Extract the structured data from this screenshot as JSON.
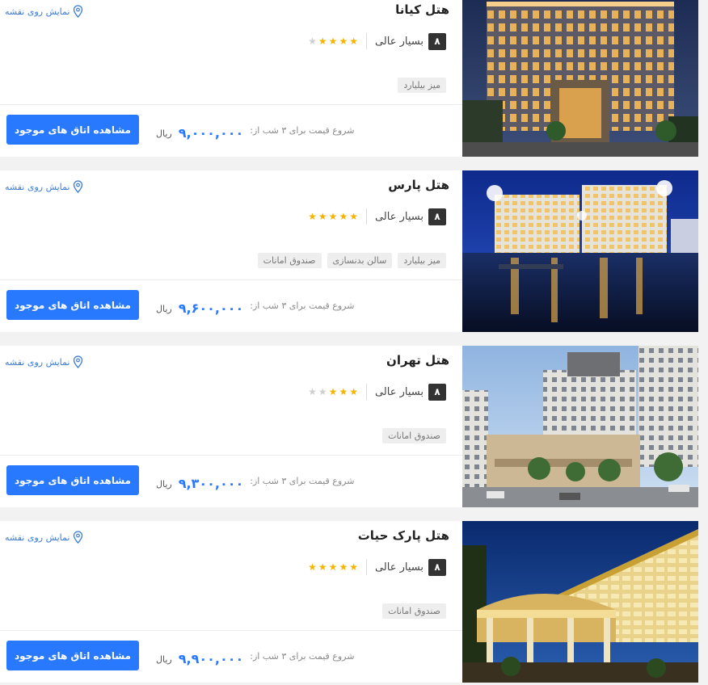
{
  "common": {
    "map_label": "نمایش روی نقشه",
    "rating_label": "بسیار عالی",
    "price_prefix": "شروع قیمت برای ۳ شب از:",
    "currency": "ریال",
    "cta_label": "مشاهده اتاق های موجود",
    "accent_color": "#2979ff",
    "star_color": "#f4b400",
    "icons": {
      "map": "map-pin-icon",
      "star": "star-icon"
    }
  },
  "hotels": [
    {
      "name": "هتل کیانا",
      "score": "۸",
      "stars": 4,
      "amenities": [
        "میز بیلیارد"
      ],
      "price": "۹,۰۰۰,۰۰۰"
    },
    {
      "name": "هتل پارس",
      "score": "۸",
      "stars": 5,
      "amenities": [
        "میز بیلیارد",
        "سالن بدنسازی",
        "صندوق امانات"
      ],
      "price": "۹,۶۰۰,۰۰۰"
    },
    {
      "name": "هتل تهران",
      "score": "۸",
      "stars": 3,
      "amenities": [
        "صندوق امانات"
      ],
      "price": "۹,۳۰۰,۰۰۰"
    },
    {
      "name": "هتل پارک حیات",
      "score": "۸",
      "stars": 5,
      "amenities": [
        "صندوق امانات"
      ],
      "price": "۹,۹۰۰,۰۰۰"
    }
  ]
}
